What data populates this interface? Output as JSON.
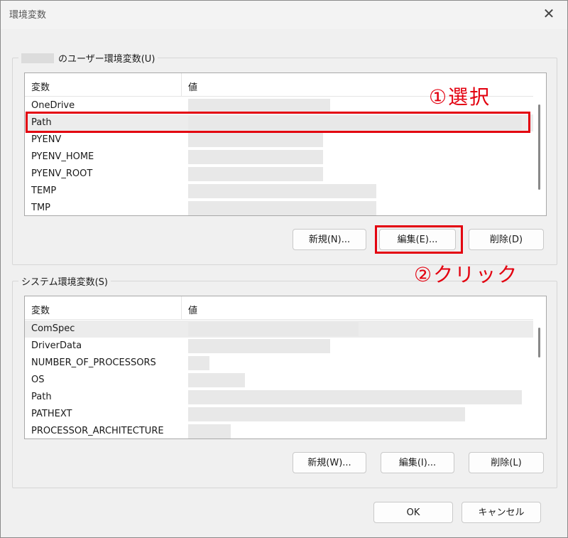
{
  "window": {
    "title": "環境変数",
    "close_glyph": "✕"
  },
  "user_group": {
    "legend": "のユーザー環境変数(U)",
    "col_variable": "変数",
    "col_value": "値",
    "rows": [
      {
        "name": "OneDrive"
      },
      {
        "name": "Path"
      },
      {
        "name": "PYENV"
      },
      {
        "name": "PYENV_HOME"
      },
      {
        "name": "PYENV_ROOT"
      },
      {
        "name": "TEMP"
      },
      {
        "name": "TMP"
      }
    ],
    "buttons": {
      "new": "新規(N)...",
      "edit": "編集(E)...",
      "delete": "削除(D)"
    }
  },
  "system_group": {
    "legend": "システム環境変数(S)",
    "col_variable": "変数",
    "col_value": "値",
    "rows": [
      {
        "name": "ComSpec"
      },
      {
        "name": "DriverData"
      },
      {
        "name": "NUMBER_OF_PROCESSORS"
      },
      {
        "name": "OS"
      },
      {
        "name": "Path"
      },
      {
        "name": "PATHEXT"
      },
      {
        "name": "PROCESSOR_ARCHITECTURE"
      }
    ],
    "buttons": {
      "new": "新規(W)...",
      "edit": "編集(I)...",
      "delete": "削除(L)"
    }
  },
  "footer": {
    "ok": "OK",
    "cancel": "キャンセル"
  },
  "annotations": {
    "step1": "①選択",
    "step2": "②クリック",
    "color": "#e3000f"
  }
}
